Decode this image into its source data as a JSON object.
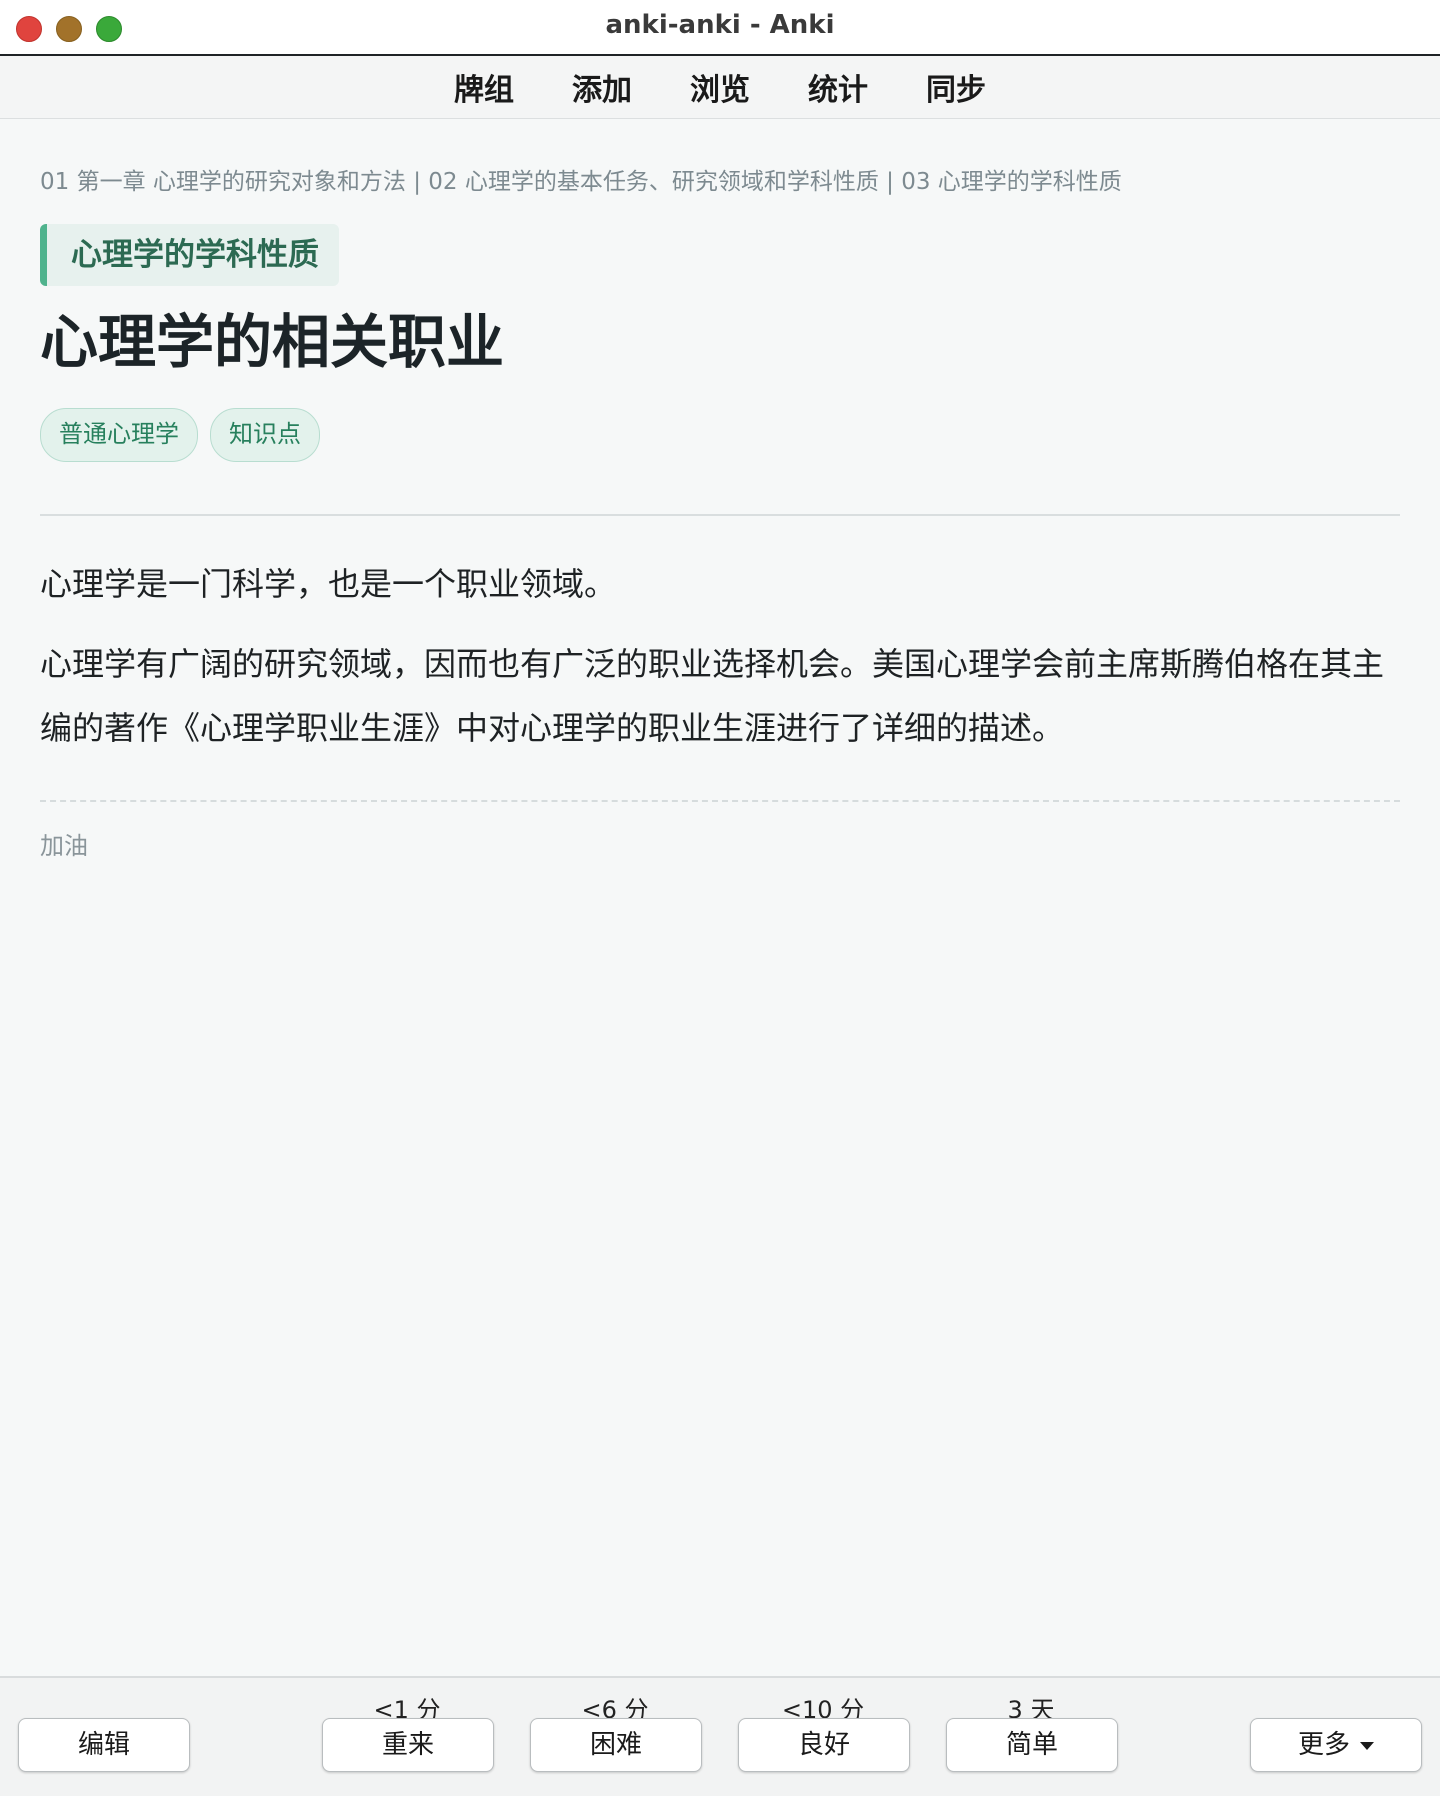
{
  "window": {
    "title": "anki-anki - Anki"
  },
  "toolbar": {
    "items": [
      "牌组",
      "添加",
      "浏览",
      "统计",
      "同步"
    ]
  },
  "card": {
    "breadcrumb": "01 第一章 心理学的研究对象和方法 | 02 心理学的基本任务、研究领域和学科性质 | 03 心理学的学科性质",
    "section": "心理学的学科性质",
    "title": "心理学的相关职业",
    "tags": [
      "普通心理学",
      "知识点"
    ],
    "paragraphs": [
      "心理学是一门科学，也是一个职业领域。",
      "心理学有广阔的研究领域，因而也有广泛的职业选择机会。美国心理学会前主席斯腾伯格在其主编的著作《心理学职业生涯》中对心理学的职业生涯进行了详细的描述。"
    ],
    "note": "加油"
  },
  "answer_bar": {
    "edit_label": "编辑",
    "more_label": "更多",
    "buttons": [
      {
        "label": "重来",
        "interval": "<1 分"
      },
      {
        "label": "困难",
        "interval": "<6 分"
      },
      {
        "label": "良好",
        "interval": "<10 分"
      },
      {
        "label": "简单",
        "interval": "3 天"
      }
    ]
  },
  "colors": {
    "accent": "#4fb38d",
    "tag_text": "#27805d",
    "background": "#f6f8f8"
  }
}
